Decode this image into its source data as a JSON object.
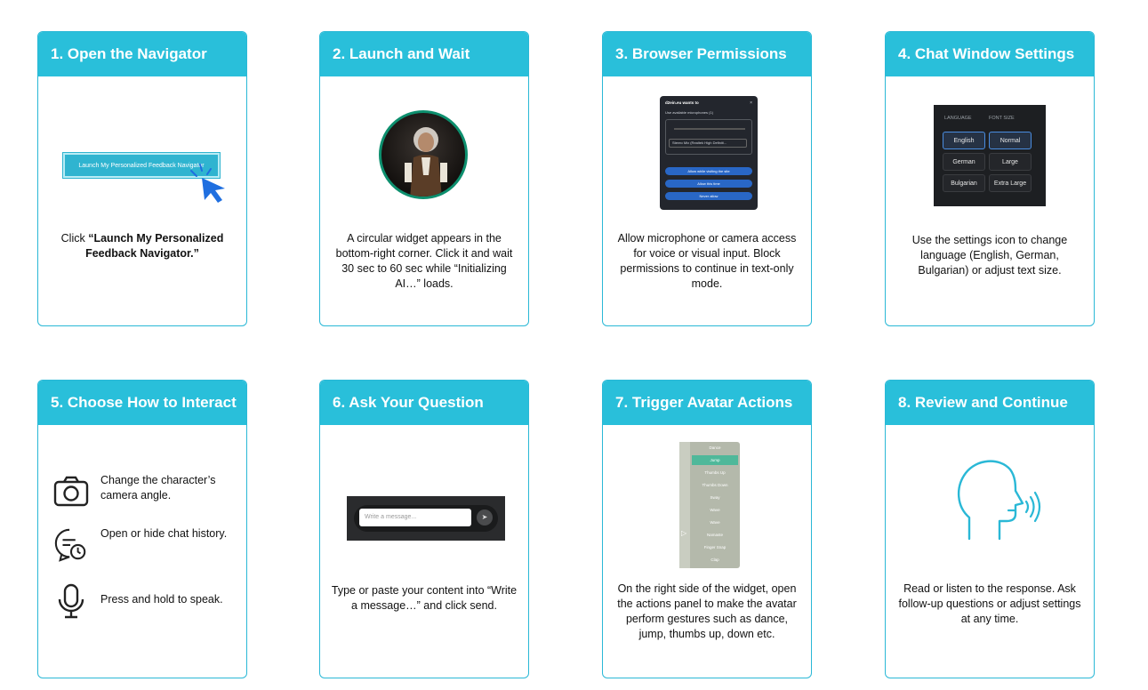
{
  "cards": [
    {
      "title": "1. Open the Navigator",
      "desc_prefix": "Click ",
      "desc_bold": "“Launch My Personalized Feedback Navigator.”"
    },
    {
      "title": "2. Launch and Wait",
      "desc": "A circular widget appears in the bottom-right corner. Click it and wait 30 sec to 60 sec while “Initializing AI…” loads."
    },
    {
      "title": "3. Browser Permissions",
      "desc": "Allow microphone or camera access for voice or visual input. Block permissions to continue in text-only mode."
    },
    {
      "title": "4. Chat Window Settings",
      "desc": "Use the settings icon to change language (English, German, Bulgarian) or adjust text size."
    },
    {
      "title": "5. Choose How to Interact"
    },
    {
      "title": "6. Ask Your Question",
      "desc": "Type or paste your content into “Write a message…” and click send."
    },
    {
      "title": "7. Trigger Avatar Actions",
      "desc": "On the right side of the widget, open the actions panel to make the avatar perform gestures such as dance, jump, thumbs up, down etc."
    },
    {
      "title": "8. Review and Continue",
      "desc": "Read or listen to the response. Ask follow-up questions or adjust settings at any time."
    }
  ],
  "launch_button_label": "Launch My Personalized Feedback Navigator",
  "permissions": {
    "title": "d2ein.eu wants to",
    "close": "×",
    "subtitle": "Use available microphones (1)",
    "device": "Stereo Mix (Realtek High Definiti...",
    "buttons": [
      "Allow while visiting the site",
      "Allow this time",
      "Never allow"
    ]
  },
  "settings": {
    "language_header": "LANGUAGE",
    "font_header": "FONT SIZE",
    "languages": [
      "English",
      "German",
      "Bulgarian"
    ],
    "font_sizes": [
      "Normal",
      "Large",
      "Extra Large"
    ]
  },
  "interact": [
    {
      "icon": "camera-icon",
      "text": "Change the character’s camera angle."
    },
    {
      "icon": "chat-history-icon",
      "text": "Open or hide chat history."
    },
    {
      "icon": "microphone-icon",
      "text": "Press and hold to speak."
    }
  ],
  "chat": {
    "placeholder": "Write a message..."
  },
  "actions": [
    "Dance",
    "Jump",
    "Thumbs Up",
    "Thumbs Down",
    "Sway",
    "Wave",
    "Wave",
    "Namaste",
    "Finger Snap",
    "Clap"
  ],
  "colors": {
    "accent": "#29bfda",
    "border": "#2ab8d6",
    "cursor": "#1f6fe0",
    "teal_icon": "#2ab8d6"
  }
}
